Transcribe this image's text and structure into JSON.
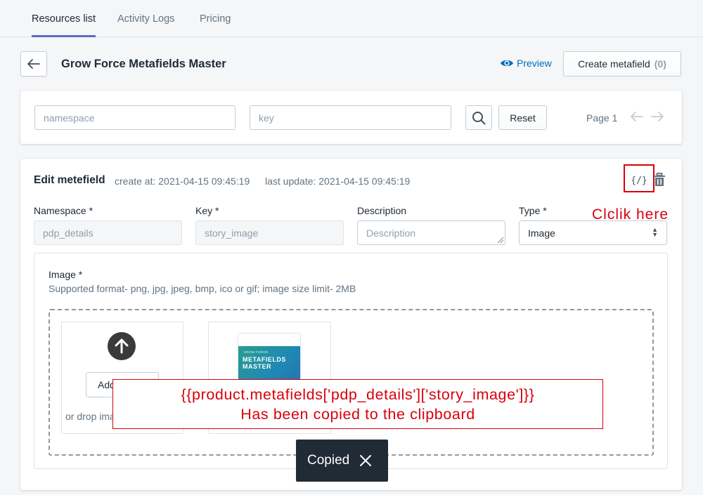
{
  "tabs": [
    {
      "label": "Resources list",
      "active": true
    },
    {
      "label": "Activity Logs",
      "active": false
    },
    {
      "label": "Pricing",
      "active": false
    }
  ],
  "header": {
    "title": "Grow Force Metafields Master",
    "preview_label": "Preview",
    "create_label": "Create metafield",
    "create_count": "(0)"
  },
  "filter": {
    "namespace_placeholder": "namespace",
    "key_placeholder": "key",
    "reset_label": "Reset",
    "page_label": "Page 1"
  },
  "edit": {
    "title": "Edit metefield",
    "created": "create at: 2021-04-15 09:45:19",
    "updated": "last update: 2021-04-15 09:45:19",
    "code_icon_text": "{/}",
    "fields": {
      "namespace_label": "Namespace *",
      "namespace_value": "pdp_details",
      "key_label": "Key *",
      "key_value": "story_image",
      "description_label": "Description",
      "description_placeholder": "Description",
      "type_label": "Type *",
      "type_value": "Image"
    },
    "image": {
      "label": "Image *",
      "help": "Supported format- png, jpg, jpeg, bmp, ico or gif; image size limit- 2MB",
      "add_label": "Add image",
      "drop_text": "or drop images to upload",
      "logo_small": "GROW FORCE",
      "logo_text": "METAFIELDS MASTER"
    }
  },
  "annotation": {
    "click_here": "Clclik here",
    "line1": "{{product.metafields['pdp_details']['story_image']}}",
    "line2": "Has been copied to the clipboard"
  },
  "toast": {
    "label": "Copied"
  },
  "colors": {
    "accent": "#5c6ac4",
    "link": "#006fbb",
    "annotation": "#d9000b",
    "toast_bg": "#212b36"
  }
}
